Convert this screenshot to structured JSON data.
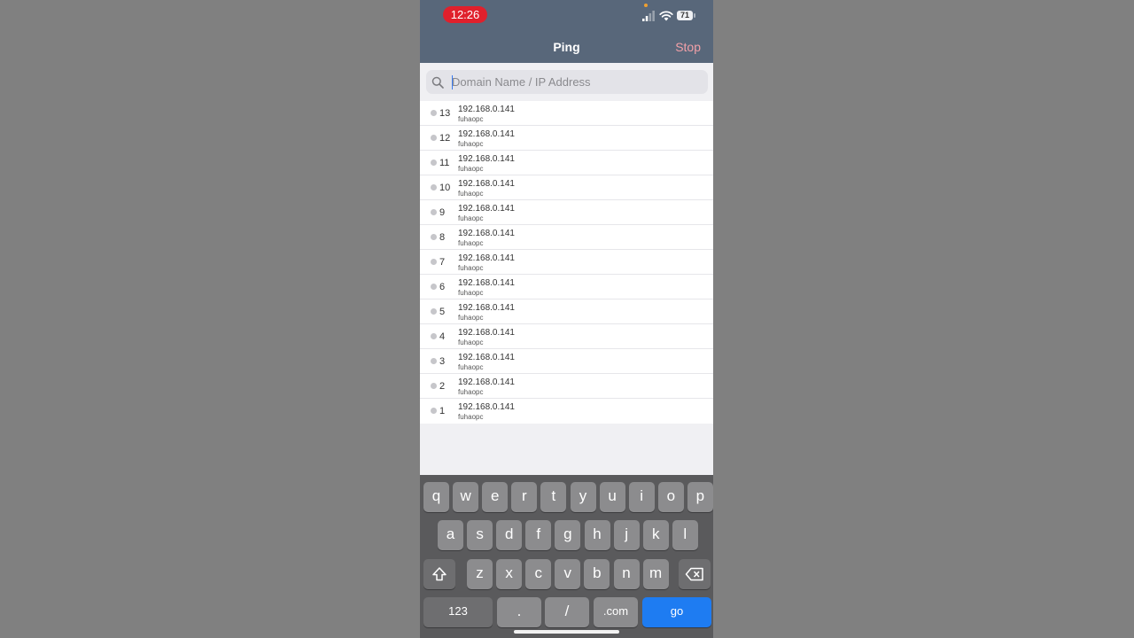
{
  "status": {
    "time": "12:26",
    "battery": "71"
  },
  "nav": {
    "title": "Ping",
    "stop_label": "Stop"
  },
  "search": {
    "placeholder": "Domain Name / IP Address",
    "value": ""
  },
  "results": [
    {
      "seq": "13",
      "ip": "192.168.0.141",
      "host": "fuhaopc"
    },
    {
      "seq": "12",
      "ip": "192.168.0.141",
      "host": "fuhaopc"
    },
    {
      "seq": "11",
      "ip": "192.168.0.141",
      "host": "fuhaopc"
    },
    {
      "seq": "10",
      "ip": "192.168.0.141",
      "host": "fuhaopc"
    },
    {
      "seq": "9",
      "ip": "192.168.0.141",
      "host": "fuhaopc"
    },
    {
      "seq": "8",
      "ip": "192.168.0.141",
      "host": "fuhaopc"
    },
    {
      "seq": "7",
      "ip": "192.168.0.141",
      "host": "fuhaopc"
    },
    {
      "seq": "6",
      "ip": "192.168.0.141",
      "host": "fuhaopc"
    },
    {
      "seq": "5",
      "ip": "192.168.0.141",
      "host": "fuhaopc"
    },
    {
      "seq": "4",
      "ip": "192.168.0.141",
      "host": "fuhaopc"
    },
    {
      "seq": "3",
      "ip": "192.168.0.141",
      "host": "fuhaopc"
    },
    {
      "seq": "2",
      "ip": "192.168.0.141",
      "host": "fuhaopc"
    },
    {
      "seq": "1",
      "ip": "192.168.0.141",
      "host": "fuhaopc"
    }
  ],
  "keyboard": {
    "row1": [
      "q",
      "w",
      "e",
      "r",
      "t",
      "y",
      "u",
      "i",
      "o",
      "p"
    ],
    "row2": [
      "a",
      "s",
      "d",
      "f",
      "g",
      "h",
      "j",
      "k",
      "l"
    ],
    "row3": [
      "z",
      "x",
      "c",
      "v",
      "b",
      "n",
      "m"
    ],
    "numbers_label": "123",
    "dot_label": ".",
    "slash_label": "/",
    "dotcom_label": ".com",
    "go_label": "go"
  },
  "colors": {
    "nav_bar": "#58677a",
    "recording_pill": "#e0202c",
    "stop": "#f2a0a8",
    "go_key": "#1e7cf2"
  },
  "icons": {
    "search": "magnifier",
    "shift": "shift-arrow",
    "delete": "backspace"
  }
}
